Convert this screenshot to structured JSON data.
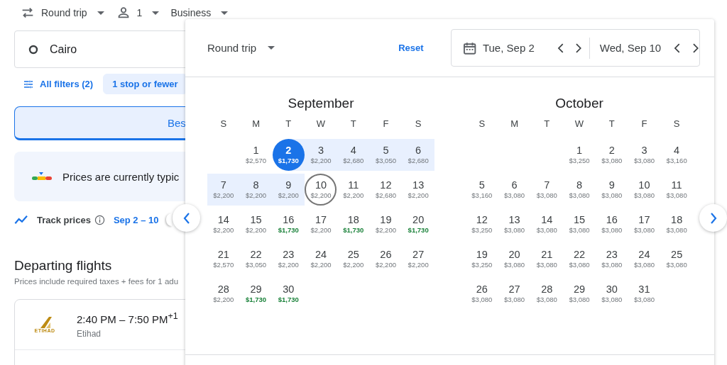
{
  "top_bar": {
    "trip_type": "Round trip",
    "passengers": "1",
    "cabin": "Business"
  },
  "origin": {
    "value": "Cairo"
  },
  "filters": {
    "all_filters": "All filters (2)",
    "chips": [
      {
        "label": "1 stop or fewer",
        "selected": true
      }
    ]
  },
  "sort_tabs": [
    {
      "label": "Bes",
      "selected": true
    }
  ],
  "price_insight": {
    "text": "Prices are currently typic"
  },
  "track_prices": {
    "label": "Track prices",
    "dates": "Sep 2 – 10",
    "on": false
  },
  "departing": {
    "title": "Departing flights",
    "subtitle": "Prices include required taxes + fees for 1 adu",
    "flights": [
      {
        "times": "2:40 PM – 7:50 PM$^{+1}$",
        "airline": "Etihad",
        "logo_text": "ETIHAD"
      }
    ]
  },
  "date_picker": {
    "trip_type": "Round trip",
    "reset": "Reset",
    "departure": "Tue, Sep 2",
    "return": "Wed, Sep 10",
    "months": [
      {
        "name": "September",
        "weekdays": [
          "S",
          "M",
          "T",
          "W",
          "T",
          "F",
          "S"
        ],
        "weeks": [
          [
            {
              "day": "1",
              "price": "$2,570",
              "low": false,
              "in_range": false,
              "selected": false,
              "focused": false
            },
            {
              "day": "2",
              "price": "$1,730",
              "low": true,
              "in_range": true,
              "selected": true,
              "focused": false
            },
            {
              "day": "3",
              "price": "$2,200",
              "low": false,
              "in_range": true,
              "selected": false,
              "focused": false
            },
            {
              "day": "4",
              "price": "$2,680",
              "low": false,
              "in_range": true,
              "selected": false,
              "focused": false
            },
            {
              "day": "5",
              "price": "$3,050",
              "low": false,
              "in_range": true,
              "selected": false,
              "focused": false
            },
            {
              "day": "6",
              "price": "$2,680",
              "low": false,
              "in_range": true,
              "selected": false,
              "focused": false
            }
          ],
          [
            {
              "day": "7",
              "price": "$2,200",
              "low": false,
              "in_range": true,
              "selected": false,
              "focused": false
            },
            {
              "day": "8",
              "price": "$2,200",
              "low": false,
              "in_range": true,
              "selected": false,
              "focused": false
            },
            {
              "day": "9",
              "price": "$2,200",
              "low": false,
              "in_range": true,
              "selected": false,
              "focused": false
            },
            {
              "day": "10",
              "price": "$2,200",
              "low": false,
              "in_range": false,
              "selected": false,
              "focused": true
            },
            {
              "day": "11",
              "price": "$2,200",
              "low": false,
              "in_range": false,
              "selected": false,
              "focused": false
            },
            {
              "day": "12",
              "price": "$2,680",
              "low": false,
              "in_range": false,
              "selected": false,
              "focused": false
            },
            {
              "day": "13",
              "price": "$2,200",
              "low": false,
              "in_range": false,
              "selected": false,
              "focused": false
            }
          ],
          [
            {
              "day": "14",
              "price": "$2,200",
              "low": false,
              "in_range": false,
              "selected": false,
              "focused": false
            },
            {
              "day": "15",
              "price": "$2,200",
              "low": false,
              "in_range": false,
              "selected": false,
              "focused": false
            },
            {
              "day": "16",
              "price": "$1,730",
              "low": true,
              "in_range": false,
              "selected": false,
              "focused": false
            },
            {
              "day": "17",
              "price": "$2,200",
              "low": false,
              "in_range": false,
              "selected": false,
              "focused": false
            },
            {
              "day": "18",
              "price": "$1,730",
              "low": true,
              "in_range": false,
              "selected": false,
              "focused": false
            },
            {
              "day": "19",
              "price": "$2,200",
              "low": false,
              "in_range": false,
              "selected": false,
              "focused": false
            },
            {
              "day": "20",
              "price": "$1,730",
              "low": true,
              "in_range": false,
              "selected": false,
              "focused": false
            }
          ],
          [
            {
              "day": "21",
              "price": "$2,570",
              "low": false,
              "in_range": false,
              "selected": false,
              "focused": false
            },
            {
              "day": "22",
              "price": "$3,050",
              "low": false,
              "in_range": false,
              "selected": false,
              "focused": false
            },
            {
              "day": "23",
              "price": "$2,200",
              "low": false,
              "in_range": false,
              "selected": false,
              "focused": false
            },
            {
              "day": "24",
              "price": "$2,200",
              "low": false,
              "in_range": false,
              "selected": false,
              "focused": false
            },
            {
              "day": "25",
              "price": "$2,200",
              "low": false,
              "in_range": false,
              "selected": false,
              "focused": false
            },
            {
              "day": "26",
              "price": "$2,200",
              "low": false,
              "in_range": false,
              "selected": false,
              "focused": false
            },
            {
              "day": "27",
              "price": "$2,200",
              "low": false,
              "in_range": false,
              "selected": false,
              "focused": false
            }
          ],
          [
            {
              "day": "28",
              "price": "$2,200",
              "low": false,
              "in_range": false,
              "selected": false,
              "focused": false
            },
            {
              "day": "29",
              "price": "$1,730",
              "low": true,
              "in_range": false,
              "selected": false,
              "focused": false
            },
            {
              "day": "30",
              "price": "$1,730",
              "low": true,
              "in_range": false,
              "selected": false,
              "focused": false
            }
          ]
        ]
      },
      {
        "name": "October",
        "weekdays": [
          "S",
          "M",
          "T",
          "W",
          "T",
          "F",
          "S"
        ],
        "weeks": [
          [
            {
              "day": "1",
              "price": "$3,250",
              "low": false,
              "in_range": false,
              "selected": false,
              "focused": false
            },
            {
              "day": "2",
              "price": "$3,080",
              "low": false,
              "in_range": false,
              "selected": false,
              "focused": false
            },
            {
              "day": "3",
              "price": "$3,080",
              "low": false,
              "in_range": false,
              "selected": false,
              "focused": false
            },
            {
              "day": "4",
              "price": "$3,160",
              "low": false,
              "in_range": false,
              "selected": false,
              "focused": false
            }
          ],
          [
            {
              "day": "5",
              "price": "$3,160",
              "low": false,
              "in_range": false,
              "selected": false,
              "focused": false
            },
            {
              "day": "6",
              "price": "$3,080",
              "low": false,
              "in_range": false,
              "selected": false,
              "focused": false
            },
            {
              "day": "7",
              "price": "$3,080",
              "low": false,
              "in_range": false,
              "selected": false,
              "focused": false
            },
            {
              "day": "8",
              "price": "$3,080",
              "low": false,
              "in_range": false,
              "selected": false,
              "focused": false
            },
            {
              "day": "9",
              "price": "$3,080",
              "low": false,
              "in_range": false,
              "selected": false,
              "focused": false
            },
            {
              "day": "10",
              "price": "$3,080",
              "low": false,
              "in_range": false,
              "selected": false,
              "focused": false
            },
            {
              "day": "11",
              "price": "$3,080",
              "low": false,
              "in_range": false,
              "selected": false,
              "focused": false
            }
          ],
          [
            {
              "day": "12",
              "price": "$3,250",
              "low": false,
              "in_range": false,
              "selected": false,
              "focused": false
            },
            {
              "day": "13",
              "price": "$3,080",
              "low": false,
              "in_range": false,
              "selected": false,
              "focused": false
            },
            {
              "day": "14",
              "price": "$3,080",
              "low": false,
              "in_range": false,
              "selected": false,
              "focused": false
            },
            {
              "day": "15",
              "price": "$3,080",
              "low": false,
              "in_range": false,
              "selected": false,
              "focused": false
            },
            {
              "day": "16",
              "price": "$3,080",
              "low": false,
              "in_range": false,
              "selected": false,
              "focused": false
            },
            {
              "day": "17",
              "price": "$3,080",
              "low": false,
              "in_range": false,
              "selected": false,
              "focused": false
            },
            {
              "day": "18",
              "price": "$3,080",
              "low": false,
              "in_range": false,
              "selected": false,
              "focused": false
            }
          ],
          [
            {
              "day": "19",
              "price": "$3,250",
              "low": false,
              "in_range": false,
              "selected": false,
              "focused": false
            },
            {
              "day": "20",
              "price": "$3,080",
              "low": false,
              "in_range": false,
              "selected": false,
              "focused": false
            },
            {
              "day": "21",
              "price": "$3,080",
              "low": false,
              "in_range": false,
              "selected": false,
              "focused": false
            },
            {
              "day": "22",
              "price": "$3,080",
              "low": false,
              "in_range": false,
              "selected": false,
              "focused": false
            },
            {
              "day": "23",
              "price": "$3,080",
              "low": false,
              "in_range": false,
              "selected": false,
              "focused": false
            },
            {
              "day": "24",
              "price": "$3,080",
              "low": false,
              "in_range": false,
              "selected": false,
              "focused": false
            },
            {
              "day": "25",
              "price": "$3,080",
              "low": false,
              "in_range": false,
              "selected": false,
              "focused": false
            }
          ],
          [
            {
              "day": "26",
              "price": "$3,080",
              "low": false,
              "in_range": false,
              "selected": false,
              "focused": false
            },
            {
              "day": "27",
              "price": "$3,080",
              "low": false,
              "in_range": false,
              "selected": false,
              "focused": false
            },
            {
              "day": "28",
              "price": "$3,080",
              "low": false,
              "in_range": false,
              "selected": false,
              "focused": false
            },
            {
              "day": "29",
              "price": "$3,080",
              "low": false,
              "in_range": false,
              "selected": false,
              "focused": false
            },
            {
              "day": "30",
              "price": "$3,080",
              "low": false,
              "in_range": false,
              "selected": false,
              "focused": false
            },
            {
              "day": "31",
              "price": "$3,080",
              "low": false,
              "in_range": false,
              "selected": false,
              "focused": false
            }
          ]
        ]
      }
    ]
  }
}
